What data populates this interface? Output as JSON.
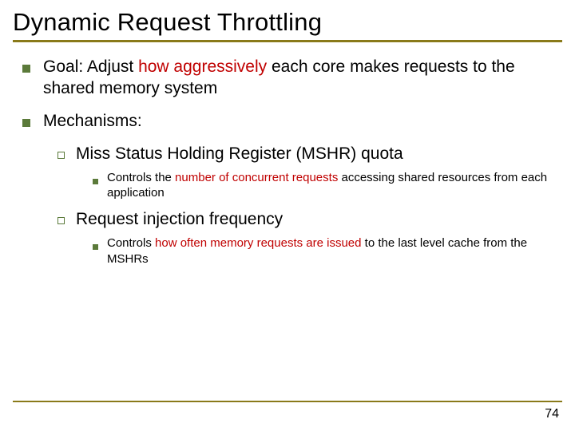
{
  "title": "Dynamic Request Throttling",
  "page_number": "74",
  "b1": {
    "pre": "Goal: Adjust ",
    "accent": "how aggressively",
    "post": " each core makes requests to the shared memory system"
  },
  "b2": {
    "text": "Mechanisms:",
    "sub1": {
      "text": "Miss Status Holding Register (MSHR) quota",
      "detail": {
        "pre": "Controls the ",
        "accent": "number of concurrent requests",
        "post": " accessing shared resources from each application"
      }
    },
    "sub2": {
      "text": "Request injection frequency",
      "detail": {
        "pre": "Controls ",
        "accent": "how often memory requests are issued",
        "post": " to the last level cache from the MSHRs"
      }
    }
  }
}
